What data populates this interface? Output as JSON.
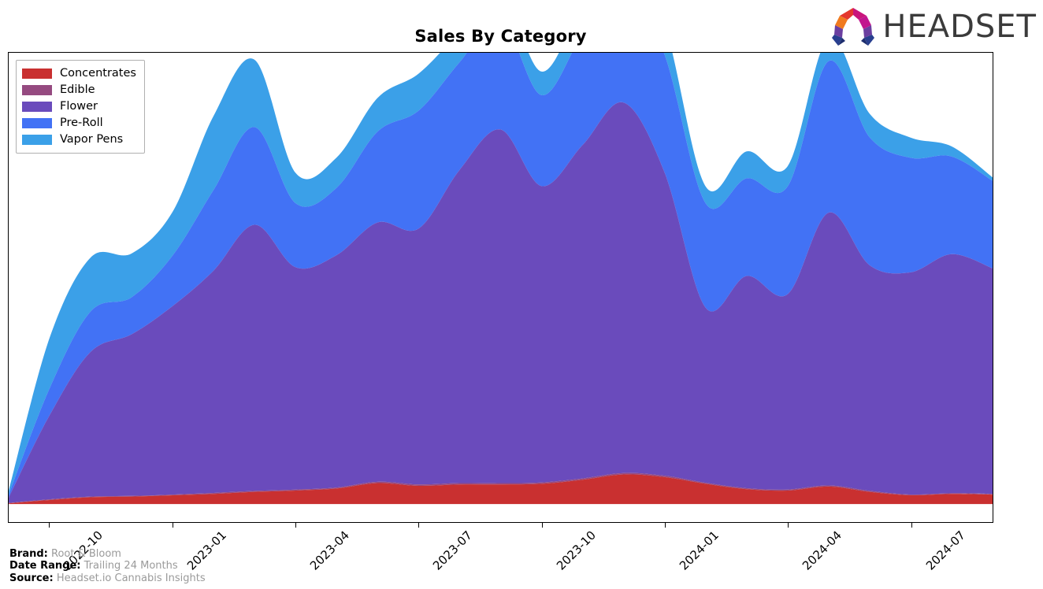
{
  "header": {
    "title": "Sales By Category",
    "logo_text": "HEADSET",
    "logo_icon": "headset-arch-logo"
  },
  "footer": {
    "rows": [
      {
        "key": "Brand:",
        "value": "Root & Bloom"
      },
      {
        "key": "Date Range:",
        "value": "Trailing 24 Months"
      },
      {
        "key": "Source:",
        "value": "Headset.io Cannabis Insights"
      }
    ]
  },
  "legend": {
    "position": "upper-left",
    "items": [
      {
        "label": "Concentrates",
        "color": "#c93030"
      },
      {
        "label": "Edible",
        "color": "#954a80"
      },
      {
        "label": "Flower",
        "color": "#6a4bbc"
      },
      {
        "label": "Pre-Roll",
        "color": "#4272f5"
      },
      {
        "label": "Vapor Pens",
        "color": "#3ba0e8"
      }
    ]
  },
  "chart_data": {
    "type": "area",
    "stacked": true,
    "smoothing": "spline",
    "title": "Sales By Category",
    "xlabel": "",
    "ylabel": "",
    "grid": false,
    "legend_position": "upper left",
    "x": [
      "2022-09",
      "2022-10",
      "2022-11",
      "2022-12",
      "2023-01",
      "2023-02",
      "2023-03",
      "2023-04",
      "2023-05",
      "2023-06",
      "2023-07",
      "2023-08",
      "2023-09",
      "2023-10",
      "2023-11",
      "2023-12",
      "2024-01",
      "2024-02",
      "2024-03",
      "2024-04",
      "2024-05",
      "2024-06",
      "2024-07",
      "2024-08",
      "2024-09"
    ],
    "tick_labels": [
      "2022-10",
      "2023-01",
      "2023-04",
      "2023-07",
      "2023-10",
      "2024-01",
      "2024-04",
      "2024-07"
    ],
    "series": [
      {
        "name": "Concentrates",
        "color": "#c93030",
        "values": [
          0.1,
          0.6,
          1.0,
          1.1,
          1.3,
          1.5,
          1.8,
          2.0,
          2.3,
          3.1,
          2.7,
          2.9,
          2.9,
          3.0,
          3.6,
          4.4,
          4.0,
          3.0,
          2.2,
          2.0,
          2.6,
          1.8,
          1.3,
          1.5,
          1.4
        ]
      },
      {
        "name": "Edible",
        "color": "#954a80",
        "values": [
          0.05,
          0.1,
          0.1,
          0.1,
          0.1,
          0.15,
          0.15,
          0.15,
          0.15,
          0.2,
          0.2,
          0.2,
          0.2,
          0.2,
          0.2,
          0.2,
          0.2,
          0.15,
          0.15,
          0.15,
          0.15,
          0.15,
          0.1,
          0.1,
          0.1
        ]
      },
      {
        "name": "Flower",
        "color": "#6a4bbc",
        "values": [
          0.8,
          12.5,
          21.5,
          24.0,
          28.0,
          33.0,
          39.5,
          33.0,
          34.5,
          38.5,
          38.0,
          46.5,
          52.5,
          44.0,
          49.5,
          55.0,
          45.0,
          26.0,
          31.5,
          29.0,
          40.5,
          33.5,
          33.0,
          35.5,
          33.5
        ]
      },
      {
        "name": "Pre-Roll",
        "color": "#4272f5",
        "values": [
          0.4,
          4.0,
          6.0,
          5.5,
          7.5,
          12.0,
          14.5,
          9.5,
          10.0,
          13.5,
          17.5,
          16.0,
          16.5,
          13.5,
          16.5,
          18.0,
          17.5,
          15.5,
          14.5,
          16.0,
          22.5,
          19.0,
          17.0,
          14.5,
          13.0
        ]
      },
      {
        "name": "Vapor Pens",
        "color": "#3ba0e8",
        "values": [
          0.6,
          7.5,
          8.0,
          6.5,
          6.5,
          11.0,
          10.0,
          4.5,
          4.5,
          5.0,
          5.5,
          4.5,
          4.0,
          3.5,
          4.5,
          5.0,
          4.5,
          2.5,
          4.0,
          3.0,
          3.5,
          3.5,
          3.0,
          1.5,
          0.5
        ]
      }
    ],
    "y_total_max": 63.5
  }
}
